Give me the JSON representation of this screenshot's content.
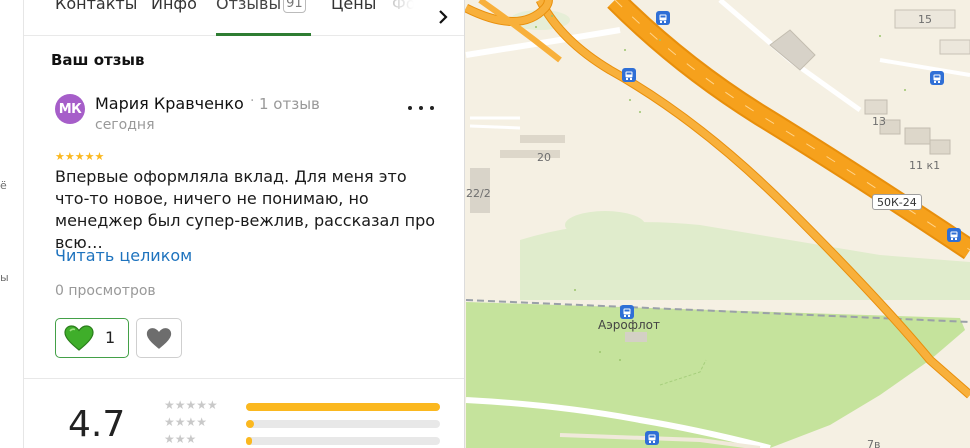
{
  "left_strip": {
    "fragments": [
      "ё",
      "ы"
    ]
  },
  "tabs": {
    "items": [
      {
        "label": "Контакты",
        "active": false
      },
      {
        "label": "Инфо",
        "active": false
      },
      {
        "label": "Отзывы",
        "count": "91",
        "active": true
      },
      {
        "label": "Цены",
        "active": false
      }
    ],
    "overflow_label": "Фо"
  },
  "review": {
    "section_title": "Ваш отзыв",
    "author_initials": "МК",
    "author_name": "Мария Кравченко",
    "author_review_count": "1 отзыв",
    "date": "сегодня",
    "rating": 5,
    "text": "Впервые оформляла вклад. Для меня это что-то новое, ничего не понимаю, но менеджер был супер-вежлив, рассказал про всю…",
    "read_more_label": "Читать целиком",
    "views": "0 просмотров",
    "likes": "1"
  },
  "rating_summary": {
    "value": "4.7",
    "distribution": [
      {
        "stars": 5,
        "share": 1.0
      },
      {
        "stars": 4,
        "share": 0.04
      },
      {
        "stars": 3,
        "share": 0.015
      }
    ]
  },
  "map": {
    "house_numbers": [
      "15",
      "13",
      "11 к1",
      "20",
      "22/2",
      "7в"
    ],
    "road_badge": "50К-24",
    "stop_name": "Аэрофлот"
  },
  "colors": {
    "accent_green": "#2e7d32",
    "star_gold": "#fbb81f",
    "link_blue": "#1e73be",
    "avatar_purple": "#a65ec9",
    "highway_orange": "#f6a11c",
    "park_green": "#c5e39c"
  }
}
